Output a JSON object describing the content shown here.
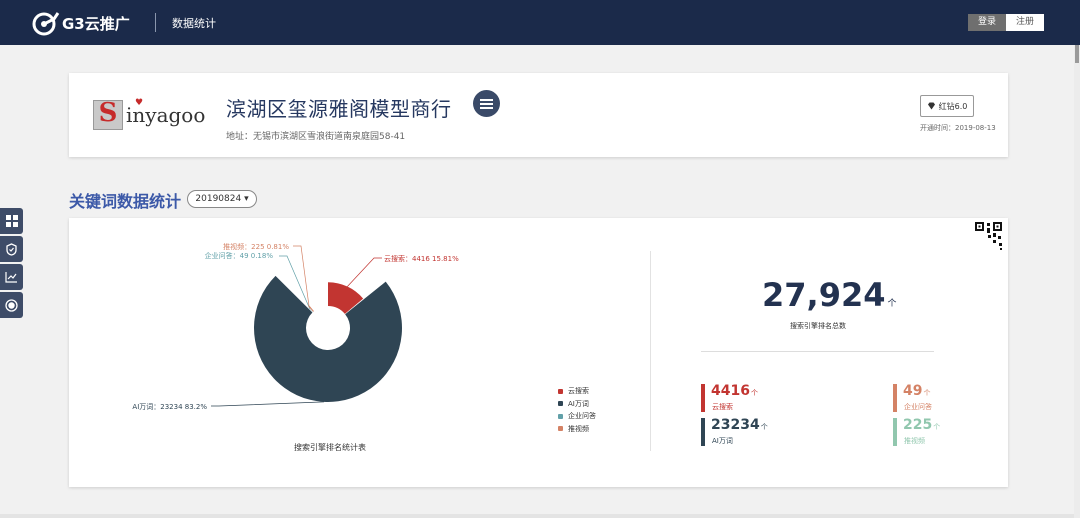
{
  "topbar": {
    "logo_text": "G3云推广",
    "page_title": "数据统计",
    "login_label": "登录",
    "register_label": "注册"
  },
  "company": {
    "brand_text": "inyagoo",
    "brand_letter": "S",
    "name": "滨湖区玺源雅阁模型商行",
    "address": "地址：无锡市滨湖区雪浪街道南泉庭园58-41",
    "level": "红钻6.0",
    "open_date": "开通时间：2019-08-13"
  },
  "keywords": {
    "title": "关键词数据统计",
    "date_value": "20190824 ▾"
  },
  "chart_data": {
    "type": "pie",
    "title": "搜索引擎排名统计表",
    "categories": [
      "云搜索",
      "AI万词",
      "企业问答",
      "推视频"
    ],
    "values": [
      4416,
      23234,
      49,
      225
    ],
    "percents": [
      "15.81%",
      "83.2%",
      "0.18%",
      "0.81%"
    ],
    "callouts": [
      "云搜索：4416   15.81%",
      "AI万词：23234   83.2%",
      "企业问答：49   0.18%",
      "推视频：225   0.81%"
    ],
    "colors": [
      "#c23531",
      "#2f4554",
      "#61a0a8",
      "#d48265"
    ],
    "legend_position": "bottom-right",
    "style": "rose-donut"
  },
  "summary": {
    "total": "27,924",
    "unit": "个",
    "total_label": "搜索引擎排名总数",
    "metrics": [
      {
        "value": "4416",
        "label": "云搜索",
        "color": "#c23531"
      },
      {
        "value": "49",
        "label": "企业问答",
        "color": "#d48265"
      },
      {
        "value": "23234",
        "label": "AI万词",
        "color": "#2f4554"
      },
      {
        "value": "225",
        "label": "推视频",
        "color": "#91c7ae"
      }
    ]
  },
  "sidebar": {
    "items": [
      "grid-icon",
      "shield-icon",
      "chart-icon",
      "record-icon"
    ]
  },
  "colors": {
    "topbar": "#1b2a4a",
    "title_blue": "#3c59a8",
    "company_name": "#263860"
  }
}
